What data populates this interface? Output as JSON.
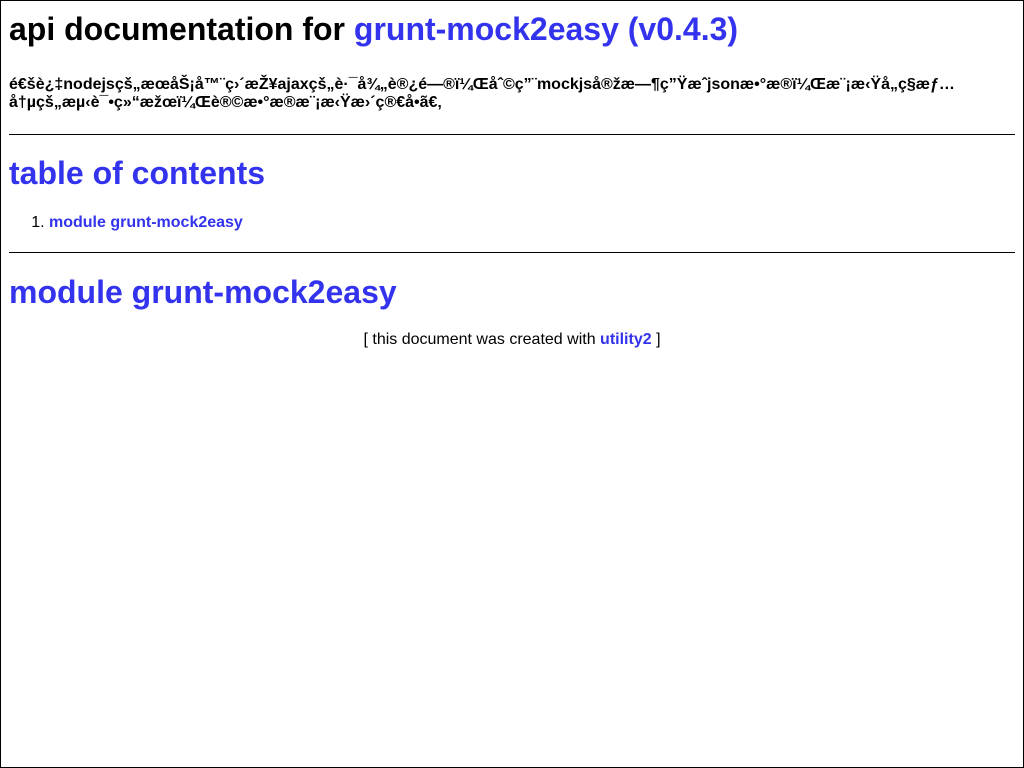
{
  "header": {
    "title_prefix": "api documentation for",
    "package_link": "grunt-mock2easy (v0.4.3)"
  },
  "description": "é€šè¿‡nodejsçš„æœåŠ¡å™¨ç›´æŽ¥ajaxçš„è·¯å¾„è®¿é—®ï¼Œåˆ©ç”¨mockjså®žæ—¶ç”Ÿæˆjsonæ•°æ®ï¼Œæ¨¡æ‹Ÿå„ç§æƒ…å†µçš„æµ‹è¯•ç»“æžœï¼Œè®©æ•°æ®æ¨¡æ‹Ÿæ›´ç®€å•ã€‚",
  "toc": {
    "title": "table of contents",
    "items": [
      {
        "number": "1.",
        "label": "module grunt-mock2easy"
      }
    ]
  },
  "module": {
    "title": "module grunt-mock2easy"
  },
  "footer": {
    "prefix": "[ this document was created with",
    "link": "utility2",
    "suffix": "]"
  }
}
